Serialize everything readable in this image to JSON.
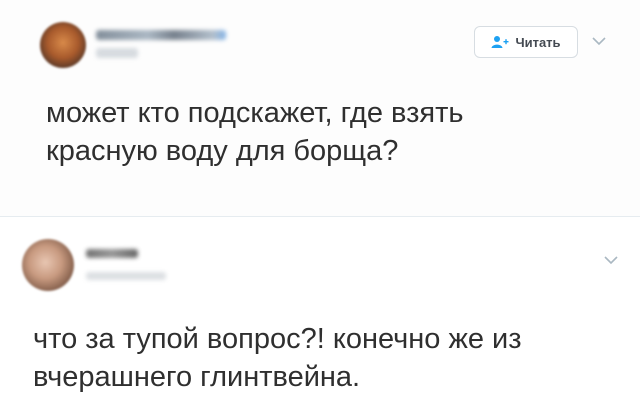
{
  "main_tweet": {
    "follow_label": "Читать",
    "text_line1": "может кто подскажет, где взять",
    "text_line2": "красную воду для борща?"
  },
  "reply_tweet": {
    "text_line1": "что за тупой вопрос?! конечно же из",
    "text_line2": "вчерашнего глинтвейна."
  },
  "icons": {
    "follow": "add-user-icon",
    "more": "chevron-down-icon"
  },
  "colors": {
    "accent": "#1da1f2",
    "text": "#2f2f2f",
    "divider": "#e6ecf0"
  }
}
